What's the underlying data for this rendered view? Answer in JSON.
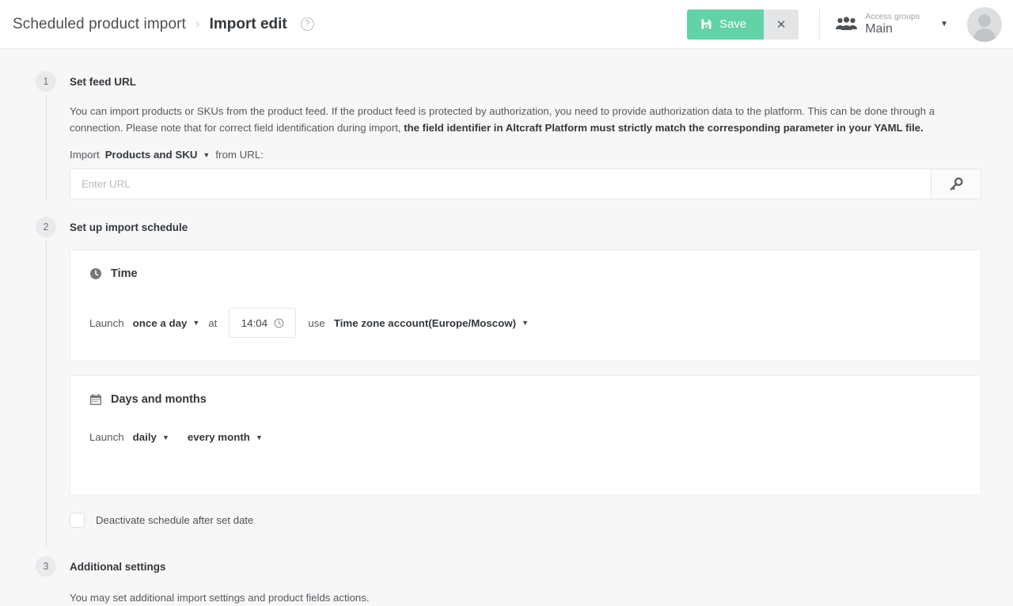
{
  "header": {
    "breadcrumb_parent": "Scheduled product import",
    "breadcrumb_separator": "›",
    "breadcrumb_current": "Import edit",
    "help_glyph": "?",
    "save_label": "Save",
    "close_glyph": "✕",
    "access_groups_label": "Access groups",
    "access_groups_value": "Main",
    "caret_glyph": "▼",
    "accent_color": "#62d2a7",
    "close_button_color": "#e4e5e7"
  },
  "steps": [
    {
      "number": "1",
      "title": "Set feed URL",
      "desc_part1": "You can import products or SKUs from the product feed. If the product feed is protected by authorization, you need to provide authorization data to the platform. This can be done through a connection. Please note that for correct field identification during import, ",
      "desc_bold": "the field identifier in Altcraft Platform must strictly match the corresponding parameter in your YAML file.",
      "import_prefix": "Import",
      "import_type": "Products and SKU",
      "import_suffix": "from URL:",
      "url_placeholder": "Enter URL",
      "key_button_name": "key-icon"
    },
    {
      "number": "2",
      "title": "Set up import schedule",
      "time_card": {
        "heading": "Time",
        "launch_label": "Launch",
        "frequency": "once a day",
        "at_label": "at",
        "time_value": "14:04",
        "use_label": "use",
        "timezone": "Time zone account(Europe/Moscow)"
      },
      "days_card": {
        "heading": "Days and months",
        "launch_label": "Launch",
        "days": "daily",
        "months": "every month"
      },
      "deactivate_label": "Deactivate schedule after set date"
    },
    {
      "number": "3",
      "title": "Additional settings",
      "desc": "You may set additional import settings and product fields actions."
    }
  ]
}
